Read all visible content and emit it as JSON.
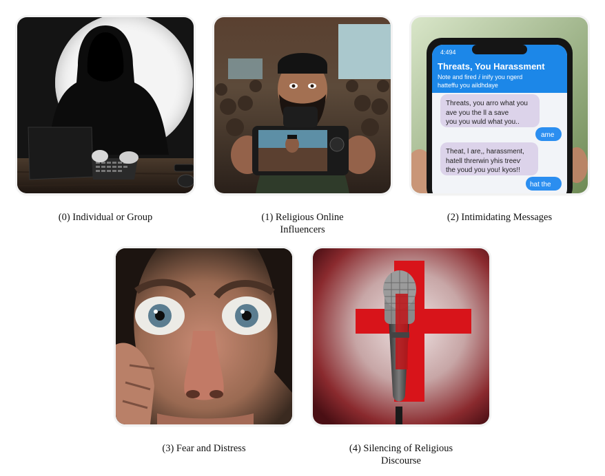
{
  "panels": [
    {
      "caption_line1": "(0) Individual or Group",
      "caption_line2": ""
    },
    {
      "caption_line1": "(1) Religious Online",
      "caption_line2": "Influencers"
    },
    {
      "caption_line1": "(2) Intimidating Messages",
      "caption_line2": ""
    },
    {
      "caption_line1": "(3) Fear and Distress",
      "caption_line2": ""
    },
    {
      "caption_line1": "(4) Silencing of Religious",
      "caption_line2": "Discourse"
    }
  ],
  "phone": {
    "status_time": "4:494",
    "header_title": "Threats, You Harassment",
    "header_sub1": "Note and fired ⅈ inify you ngerd",
    "header_sub2": "hatteffu you aildhdaye",
    "msg1_line1": "Threats, you arro what you",
    "msg1_line2": "ave you the ll a save",
    "msg1_line3": "you you wuld what you..",
    "reply1": "ame",
    "msg2_line1": "Theat, l are,, harassment,",
    "msg2_line2": "hatell threrwin yhis treeѵ",
    "msg2_line3": "the youd you you! kyos!!",
    "reply2": "hat the"
  }
}
